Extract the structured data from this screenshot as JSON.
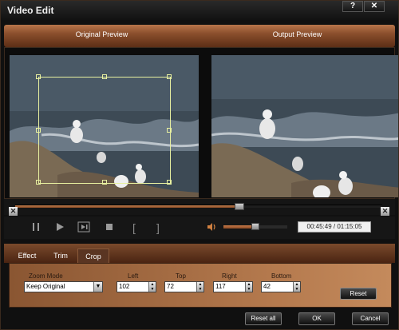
{
  "window": {
    "title": "Video Edit"
  },
  "titlebar": {
    "help_glyph": "?",
    "close_glyph": "✕"
  },
  "preview": {
    "original_label": "Original Preview",
    "output_label": "Output Preview"
  },
  "playback": {
    "seek_progress": 0.61,
    "volume_level": 0.5,
    "time_display": "00:45:49 / 01:15:05",
    "icons": [
      "pause-icon",
      "play-icon",
      "step-forward-icon",
      "stop-icon",
      "mark-in-icon",
      "mark-out-icon",
      "volume-icon"
    ],
    "mark_in_glyph": "[",
    "mark_out_glyph": "]"
  },
  "tabs": [
    {
      "label": "Effect",
      "active": false
    },
    {
      "label": "Trim",
      "active": false
    },
    {
      "label": "Crop",
      "active": true
    }
  ],
  "crop": {
    "zoom_mode_label": "Zoom Mode",
    "zoom_mode_value": "Keep Original",
    "left_label": "Left",
    "left_value": "102",
    "top_label": "Top",
    "top_value": "72",
    "right_label": "Right",
    "right_value": "117",
    "bottom_label": "Bottom",
    "bottom_value": "42",
    "reset_label": "Reset"
  },
  "footer": {
    "reset_all_label": "Reset all",
    "ok_label": "OK",
    "cancel_label": "Cancel"
  },
  "colors": {
    "accent": "#a05a32",
    "crop_frame": "#e8f0a0",
    "panel_bg": "#b57a4e"
  }
}
